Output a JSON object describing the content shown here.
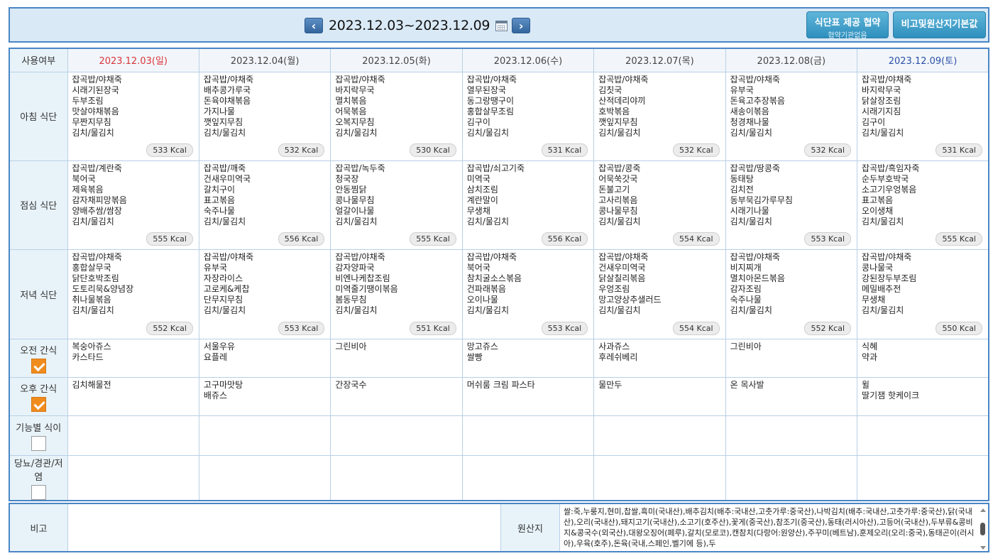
{
  "header": {
    "prev_glyph": "‹",
    "next_glyph": "›",
    "week_range": "2023.12.03~2023.12.09",
    "agree_button": {
      "label": "식단표 제공 협약",
      "sub": "협약기관없음"
    },
    "basic_button": "비고및원산지기본값"
  },
  "table": {
    "corner": "사용여부",
    "days": [
      {
        "label": "2023.12.03(일)",
        "color": "#d9343a"
      },
      {
        "label": "2023.12.04(월)",
        "color": "#444444"
      },
      {
        "label": "2023.12.05(화)",
        "color": "#444444"
      },
      {
        "label": "2023.12.06(수)",
        "color": "#444444"
      },
      {
        "label": "2023.12.07(목)",
        "color": "#444444"
      },
      {
        "label": "2023.12.08(금)",
        "color": "#444444"
      },
      {
        "label": "2023.12.09(토)",
        "color": "#2b4fa8"
      }
    ],
    "meals": [
      {
        "label": "아침 식단",
        "cells": [
          {
            "items": [
              "잡곡밥/야채죽",
              "시래기된장국",
              "두부조림",
              "맛살야채볶음",
              "무짠지무침",
              "김치/물김치"
            ],
            "kcal": "533 Kcal"
          },
          {
            "items": [
              "잡곡밥/야채죽",
              "배추콩가루국",
              "돈육야채볶음",
              "가지나물",
              "깻잎지무침",
              "김치/물김치"
            ],
            "kcal": "532 Kcal"
          },
          {
            "items": [
              "잡곡밥/야채죽",
              "바지락무국",
              "멸치볶음",
              "어묵볶음",
              "오복지무침",
              "김치/물김치"
            ],
            "kcal": "530 Kcal"
          },
          {
            "items": [
              "잡곡밥/야채죽",
              "열무된장국",
              "동그랑땡구이",
              "홍합살무조림",
              "김구이",
              "김치/물김치"
            ],
            "kcal": "531 Kcal"
          },
          {
            "items": [
              "잡곡밥/야채죽",
              "김칫국",
              "산적데리야끼",
              "호박볶음",
              "깻잎지무침",
              "김치/물김치"
            ],
            "kcal": "532 Kcal"
          },
          {
            "items": [
              "잡곡밥/야채죽",
              "유부국",
              "돈육고추장볶음",
              "새송이볶음",
              "청경채나물",
              "김치/물김치"
            ],
            "kcal": "532 Kcal"
          },
          {
            "items": [
              "잡곡밥/야채죽",
              "바지락무국",
              "닭살장조림",
              "시래기지짐",
              "김구이",
              "김치/물김치"
            ],
            "kcal": "531 Kcal"
          }
        ]
      },
      {
        "label": "점심 식단",
        "cells": [
          {
            "items": [
              "잡곡밥/계란죽",
              "북어국",
              "제육볶음",
              "감자채피망볶음",
              "양배추쌈/쌈장",
              "김치/물김치"
            ],
            "kcal": "555 Kcal"
          },
          {
            "items": [
              "잡곡밥/깨죽",
              "건새우미역국",
              "갈치구이",
              "표고볶음",
              "숙주나물",
              "김치/물김치"
            ],
            "kcal": "556 Kcal"
          },
          {
            "items": [
              "잡곡밥/녹두죽",
              "청국장",
              "안동찜닭",
              "콩나물무침",
              "얼갈이나물",
              "김치/물김치"
            ],
            "kcal": "555 Kcal"
          },
          {
            "items": [
              "잡곡밥/쇠고기죽",
              "미역국",
              "삼치조림",
              "계란말이",
              "무생채",
              "김치/물김치"
            ],
            "kcal": "556 Kcal"
          },
          {
            "items": [
              "잡곡밥/콩죽",
              "어묵쑥갓국",
              "돈불고기",
              "고사리볶음",
              "콩나물무침",
              "김치/물김치"
            ],
            "kcal": "554 Kcal"
          },
          {
            "items": [
              "잡곡밥/땅콩죽",
              "동태탕",
              "김치전",
              "동부묵김가루무침",
              "시래기나물",
              "김치/물김치"
            ],
            "kcal": "553 Kcal"
          },
          {
            "items": [
              "잡곡밥/흑임자죽",
              "순두부호박국",
              "소고기우엉볶음",
              "표고볶음",
              "오이생채",
              "김치/물김치"
            ],
            "kcal": "555 Kcal"
          }
        ]
      },
      {
        "label": "저녁 식단",
        "cells": [
          {
            "items": [
              "잡곡밥/야채죽",
              "홍합살무국",
              "닭단호박조림",
              "도토리묵&양념장",
              "취나물볶음",
              "김치/물김치"
            ],
            "kcal": "552 Kcal"
          },
          {
            "items": [
              "잡곡밥/야채죽",
              "유부국",
              "자장라이스",
              "고로케&케찹",
              "단무지무침",
              "김치/물김치"
            ],
            "kcal": "553 Kcal"
          },
          {
            "items": [
              "잡곡밥/야채죽",
              "감자양파국",
              "비엔나케찹조림",
              "미역줄기땡이볶음",
              "봄동무침",
              "김치/물김치"
            ],
            "kcal": "551 Kcal"
          },
          {
            "items": [
              "잡곡밥/야채죽",
              "북어국",
              "참치굴소스볶음",
              "건파래볶음",
              "오이나물",
              "김치/물김치"
            ],
            "kcal": "553 Kcal"
          },
          {
            "items": [
              "잡곡밥/야채죽",
              "건새우미역국",
              "닭살칠리볶음",
              "우엉조림",
              "망고양상추샐러드",
              "김치/물김치"
            ],
            "kcal": "554 Kcal"
          },
          {
            "items": [
              "잡곡밥/야채죽",
              "비지찌개",
              "멸치아몬드볶음",
              "감자조림",
              "숙주나물",
              "김치/물김치"
            ],
            "kcal": "552 Kcal"
          },
          {
            "items": [
              "잡곡밥/야채죽",
              "콩나물국",
              "강된장두부조림",
              "메밀배추전",
              "무생채",
              "김치/물김치"
            ],
            "kcal": "550 Kcal"
          }
        ]
      }
    ],
    "snacks": [
      {
        "label": "오전 간식",
        "checked": true,
        "cells": [
          [
            "복숭아쥬스",
            "카스타드"
          ],
          [
            "서울우유",
            "요플레"
          ],
          [
            "그린비아"
          ],
          [
            "망고쥬스",
            "쌀빵"
          ],
          [
            "사과쥬스",
            "후레쉬베리"
          ],
          [
            "그린비아"
          ],
          [
            "식혜",
            "약과"
          ]
        ]
      },
      {
        "label": "오후 간식",
        "checked": true,
        "cells": [
          [
            "김치해물전"
          ],
          [
            "고구마맛탕",
            "배쥬스"
          ],
          [
            "간장국수"
          ],
          [
            "머쉬룸 크림 파스타"
          ],
          [
            "물만두"
          ],
          [
            "온 목사발"
          ],
          [
            "윌",
            "딸기잼 핫케이크"
          ]
        ]
      },
      {
        "label": "기능별 식이",
        "checked": false,
        "cells": [
          [],
          [],
          [],
          [],
          [],
          [],
          []
        ]
      },
      {
        "label": "당뇨/경관/저염",
        "checked": false,
        "cells": [
          [],
          [],
          [],
          [],
          [],
          [],
          []
        ]
      }
    ]
  },
  "footer": {
    "note_label": "비고",
    "note_value": "",
    "origin_label": "원산지",
    "origin_text": "쌀:죽,누룽지,현미,찹쌀,흑미(국내산),배추김치(배추:국내산,고춧가루:중국산),나박김치(배추:국내산,고춧가루:중국산),닭(국내산),오리(국내산),돼지고기(국내산),소고기(호주산),꽃게(중국산),참조기(중국산),동태(러시아산),고등어(국내산),두부류&콩비지&콩국수(외국산),대왕오징어(페루),갈치(모로코),캔참치(다랑어:원양산),주꾸미(베트남),훈제오리(오리:중국),동태곤이(러시아),우육(호주),돈육(국내,스페인,벨기에 등),두"
  }
}
